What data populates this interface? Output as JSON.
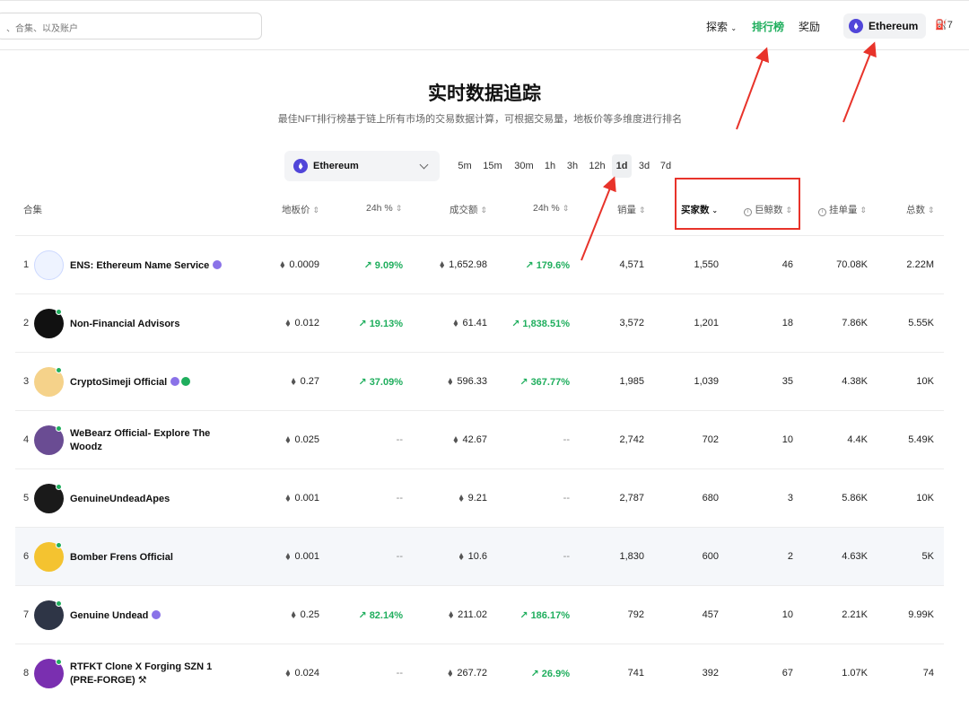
{
  "header": {
    "search_placeholder": "、合集、以及账户",
    "nav": [
      "探索",
      "排行榜",
      "奖励"
    ],
    "chain": "Ethereum",
    "gas": "7"
  },
  "hero": {
    "title": "实时数据追踪",
    "subtitle": "最佳NFT排行榜基于链上所有市场的交易数据计算，可根据交易量，地板价等多维度进行排名"
  },
  "filters": {
    "chain": "Ethereum",
    "time_tabs": [
      "5m",
      "15m",
      "30m",
      "1h",
      "3h",
      "12h",
      "1d",
      "3d",
      "7d"
    ],
    "active_tab": "1d"
  },
  "table": {
    "headers": {
      "collection": "合集",
      "floor": "地板价",
      "floor_change": "24h %",
      "volume": "成交额",
      "volume_change": "24h %",
      "sales": "销量",
      "buyers": "买家数",
      "whales": "巨鲸数",
      "listed": "挂单量",
      "supply": "总数"
    },
    "rows": [
      {
        "rank": "1",
        "name": "ENS: Ethereum Name Service",
        "floor": "0.0009",
        "floor_change": "9.09%",
        "volume": "1,652.98",
        "volume_change": "179.6%",
        "sales": "4,571",
        "buyers": "1,550",
        "whales": "46",
        "listed": "70.08K",
        "supply": "2.22M"
      },
      {
        "rank": "2",
        "name": "Non-Financial Advisors",
        "floor": "0.012",
        "floor_change": "19.13%",
        "volume": "61.41",
        "volume_change": "1,838.51%",
        "sales": "3,572",
        "buyers": "1,201",
        "whales": "18",
        "listed": "7.86K",
        "supply": "5.55K"
      },
      {
        "rank": "3",
        "name": "CryptoSimeji Official",
        "floor": "0.27",
        "floor_change": "37.09%",
        "volume": "596.33",
        "volume_change": "367.77%",
        "sales": "1,985",
        "buyers": "1,039",
        "whales": "35",
        "listed": "4.38K",
        "supply": "10K"
      },
      {
        "rank": "4",
        "name": "WeBearz Official- Explore The Woodz",
        "floor": "0.025",
        "floor_change": "--",
        "volume": "42.67",
        "volume_change": "--",
        "sales": "2,742",
        "buyers": "702",
        "whales": "10",
        "listed": "4.4K",
        "supply": "5.49K"
      },
      {
        "rank": "5",
        "name": "GenuineUndeadApes",
        "floor": "0.001",
        "floor_change": "--",
        "volume": "9.21",
        "volume_change": "--",
        "sales": "2,787",
        "buyers": "680",
        "whales": "3",
        "listed": "5.86K",
        "supply": "10K"
      },
      {
        "rank": "6",
        "name": "Bomber Frens Official",
        "floor": "0.001",
        "floor_change": "--",
        "volume": "10.6",
        "volume_change": "--",
        "sales": "1,830",
        "buyers": "600",
        "whales": "2",
        "listed": "4.63K",
        "supply": "5K"
      },
      {
        "rank": "7",
        "name": "Genuine Undead",
        "floor": "0.25",
        "floor_change": "82.14%",
        "volume": "211.02",
        "volume_change": "186.17%",
        "sales": "792",
        "buyers": "457",
        "whales": "10",
        "listed": "2.21K",
        "supply": "9.99K"
      },
      {
        "rank": "8",
        "name": "RTFKT Clone X Forging SZN 1 (PRE-FORGE) ⚒",
        "floor": "0.024",
        "floor_change": "--",
        "volume": "267.72",
        "volume_change": "26.9%",
        "sales": "741",
        "buyers": "392",
        "whales": "67",
        "listed": "1.07K",
        "supply": "74"
      }
    ]
  },
  "colors": {
    "accent": "#1fae5d",
    "annotation": "#e8332a",
    "eth": "#5146d9"
  }
}
